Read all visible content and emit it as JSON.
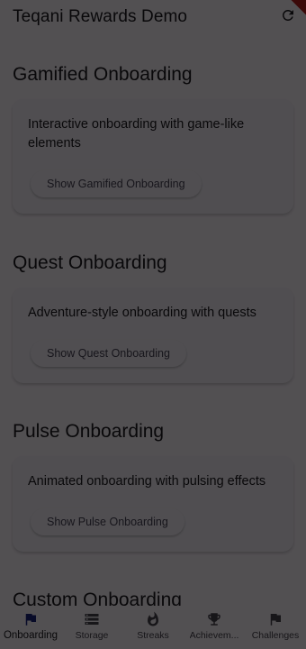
{
  "appbar": {
    "title": "Teqani Rewards Demo",
    "refresh_icon": "refresh-icon"
  },
  "sections": [
    {
      "title": "Gamified Onboarding",
      "description": "Interactive onboarding with game-like elements",
      "button": "Show Gamified Onboarding"
    },
    {
      "title": "Quest Onboarding",
      "description": "Adventure-style onboarding with quests",
      "button": "Show Quest Onboarding"
    },
    {
      "title": "Pulse Onboarding",
      "description": "Animated onboarding with pulsing effects",
      "button": "Show Pulse Onboarding"
    },
    {
      "title": "Custom Onboarding"
    }
  ],
  "navbar": {
    "items": [
      {
        "label": "Onboarding",
        "icon": "flag-icon",
        "active": true
      },
      {
        "label": "Storage",
        "icon": "storage-icon"
      },
      {
        "label": "Streaks",
        "icon": "fire-icon"
      },
      {
        "label": "Achievem...",
        "icon": "trophy-icon"
      },
      {
        "label": "Challenges",
        "icon": "flag-icon"
      }
    ]
  },
  "colors": {
    "surface": "#fef7ff",
    "card": "#f7f2fa",
    "active_nav": "#1a237e",
    "scrim": "rgba(0,0,0,0.68)"
  }
}
